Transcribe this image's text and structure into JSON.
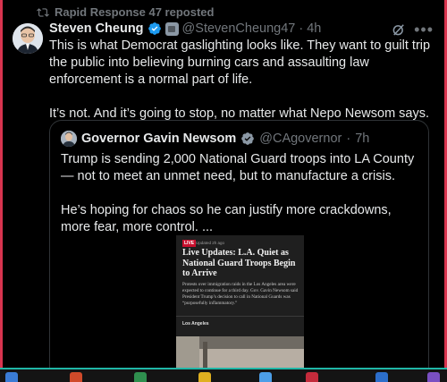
{
  "repost": {
    "label": "Rapid Response 47 reposted",
    "icon": "repost-icon"
  },
  "author": {
    "name": "Steven Cheung",
    "handle": "@StevenCheung47",
    "separator": "·",
    "time": "4h"
  },
  "post": {
    "paragraphs": [
      "This is what Democrat gaslighting looks like. They want to guilt trip the public into believing burning cars and assaulting law enforcement is a normal part of life.",
      "It’s not. And it’s going to stop, no matter what Nepo Newsom says."
    ]
  },
  "quote": {
    "name": "Governor Gavin Newsom",
    "handle": "@CAgovernor",
    "separator": "·",
    "time": "7h",
    "paragraphs": [
      "Trump is sending 2,000 National Guard troops into LA County — not to meet an unmet need, but to manufacture a crisis.",
      "He’s hoping for chaos so he can justify more crackdowns, more fear, more control. ..."
    ],
    "article": {
      "badge": "LIVE",
      "meta": "Updated 2h ago",
      "title": "Live Updates: L.A. Quiet as National Guard Troops Begin to Arrive",
      "summary": "Protests over immigration raids in the Los Angeles area were expected to continue for a third day. Gov. Gavin Newsom said President Trump’s decision to call in National Guards was “purposefully inflammatory.”",
      "location": "Los Angeles"
    }
  },
  "icons": {
    "verified": "verified-badge-icon",
    "affiliation": "affiliation-badge-icon",
    "grok": "grok-icon",
    "more": "more-options-icon"
  },
  "colors": {
    "background": "#000000",
    "text": "#e7e9ea",
    "muted": "#71767b",
    "verified": "#1d9bf0",
    "border": "#2f3336",
    "live_red": "#c8102e",
    "frame_accent": "#d9344f",
    "taskbar_accent": "#1fb6a6"
  }
}
